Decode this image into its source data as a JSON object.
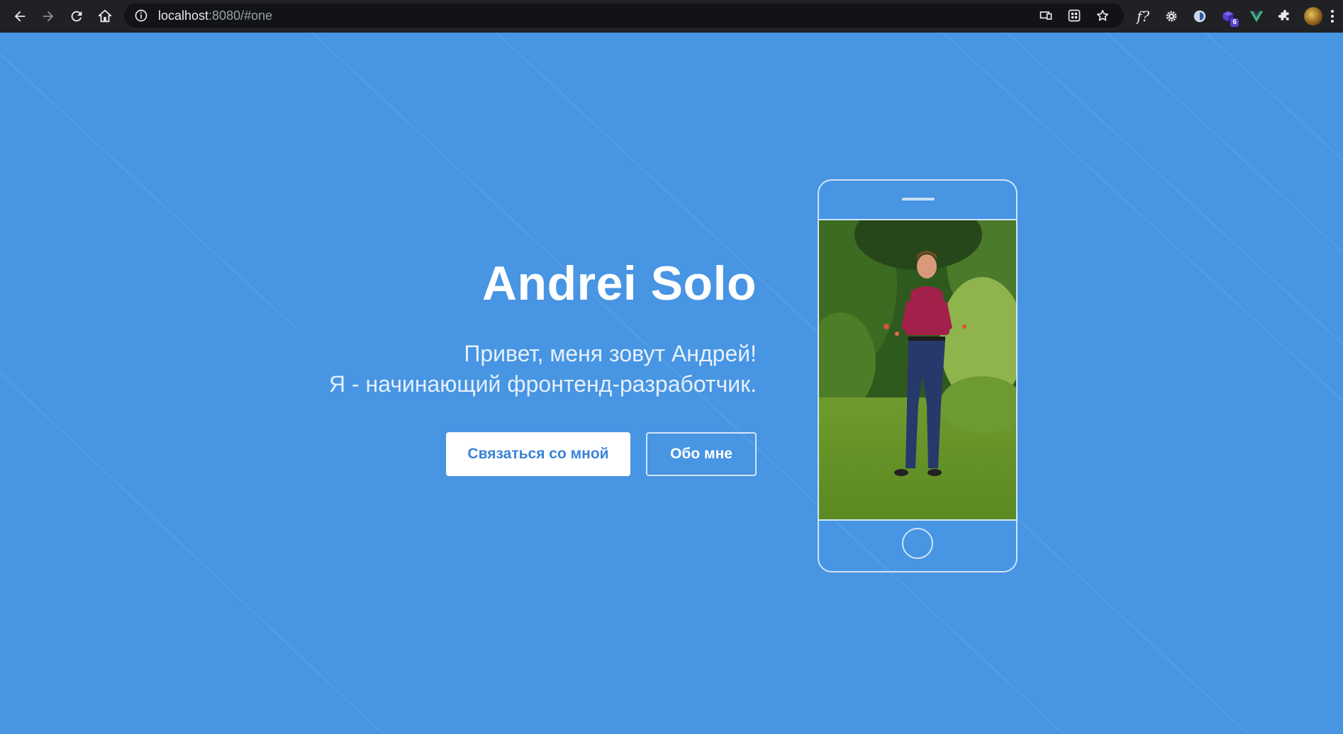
{
  "browser": {
    "url_host": "localhost",
    "url_rest": ":8080/#one",
    "extensions": {
      "fx_label": "f?",
      "badge_count": "6"
    }
  },
  "hero": {
    "title": "Andrei Solo",
    "subtitle_line1": "Привет, меня зовут Андрей!",
    "subtitle_line2": "Я - начинающий фронтенд-разработчик.",
    "primary_button": "Связаться со мной",
    "secondary_button": "Обо мне"
  },
  "colors": {
    "page_background": "#4795e3",
    "primary_button_text": "#3a83d6",
    "toolbar": "#202124"
  },
  "icons": {
    "back": "arrow-left",
    "forward": "arrow-right",
    "reload": "reload",
    "home": "home",
    "site_info": "info",
    "cast": "cast",
    "qr": "qr-code",
    "bookmark": "star",
    "extensions": "puzzle",
    "menu": "vertical-dots"
  }
}
